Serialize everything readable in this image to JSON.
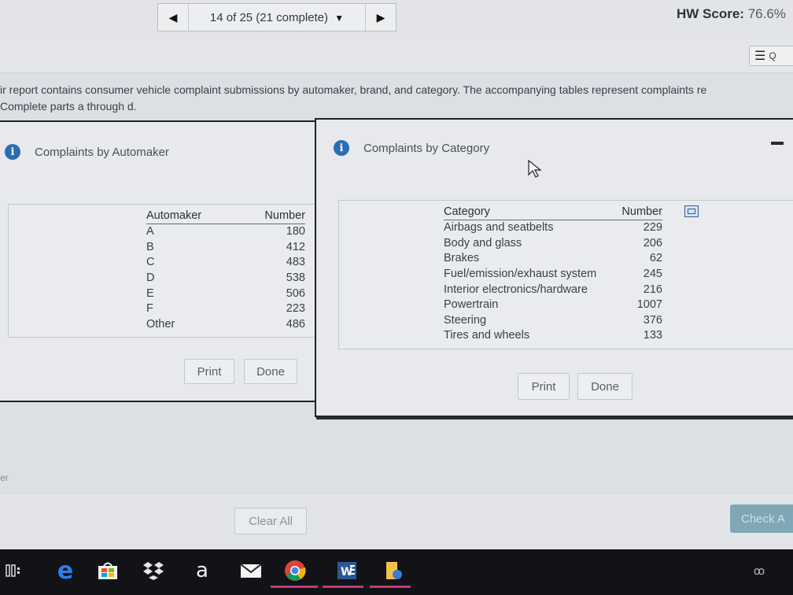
{
  "nav": {
    "prev_icon": "triangle-left-icon",
    "question_status": "14 of 25 (21 complete)",
    "dropdown_icon": "triangle-down-icon",
    "next_icon": "triangle-right-icon",
    "hw_score_label": "HW Score:",
    "hw_score_value": "76.6%"
  },
  "question_list_button": {
    "icon": "list-icon",
    "label": "Q"
  },
  "prompt": {
    "line1": "ir report contains consumer vehicle complaint submissions by automaker, brand, and category. The accompanying tables represent complaints re",
    "line2": "Complete parts a through d."
  },
  "automaker_dialog": {
    "title": "Complaints by Automaker",
    "columns": [
      "Automaker",
      "Number"
    ],
    "rows": [
      [
        "A",
        "180"
      ],
      [
        "B",
        "412"
      ],
      [
        "C",
        "483"
      ],
      [
        "D",
        "538"
      ],
      [
        "E",
        "506"
      ],
      [
        "F",
        "223"
      ],
      [
        "Other",
        "486"
      ]
    ],
    "print_label": "Print",
    "done_label": "Done"
  },
  "category_dialog": {
    "title": "Complaints by Category",
    "columns": [
      "Category",
      "Number"
    ],
    "rows": [
      [
        "Airbags and seatbelts",
        "229"
      ],
      [
        "Body and glass",
        "206"
      ],
      [
        "Brakes",
        "62"
      ],
      [
        "Fuel/emission/exhaust system",
        "245"
      ],
      [
        "Interior electronics/hardware",
        "216"
      ],
      [
        "Powertrain",
        "1007"
      ],
      [
        "Steering",
        "376"
      ],
      [
        "Tires and wheels",
        "133"
      ]
    ],
    "print_label": "Print",
    "done_label": "Done"
  },
  "side_text": "er",
  "clear_all_label": "Clear All",
  "check_answer_label": "Check A",
  "colors": {
    "info_blue": "#2a6db3",
    "check_button": "#7fa7b6",
    "taskbar": "#111317"
  },
  "taskbar_icons": [
    "task-view-icon",
    "edge-icon",
    "store-icon",
    "dropbox-icon",
    "amazon-icon",
    "mail-icon",
    "chrome-icon",
    "word-icon",
    "file-explorer-icon"
  ]
}
